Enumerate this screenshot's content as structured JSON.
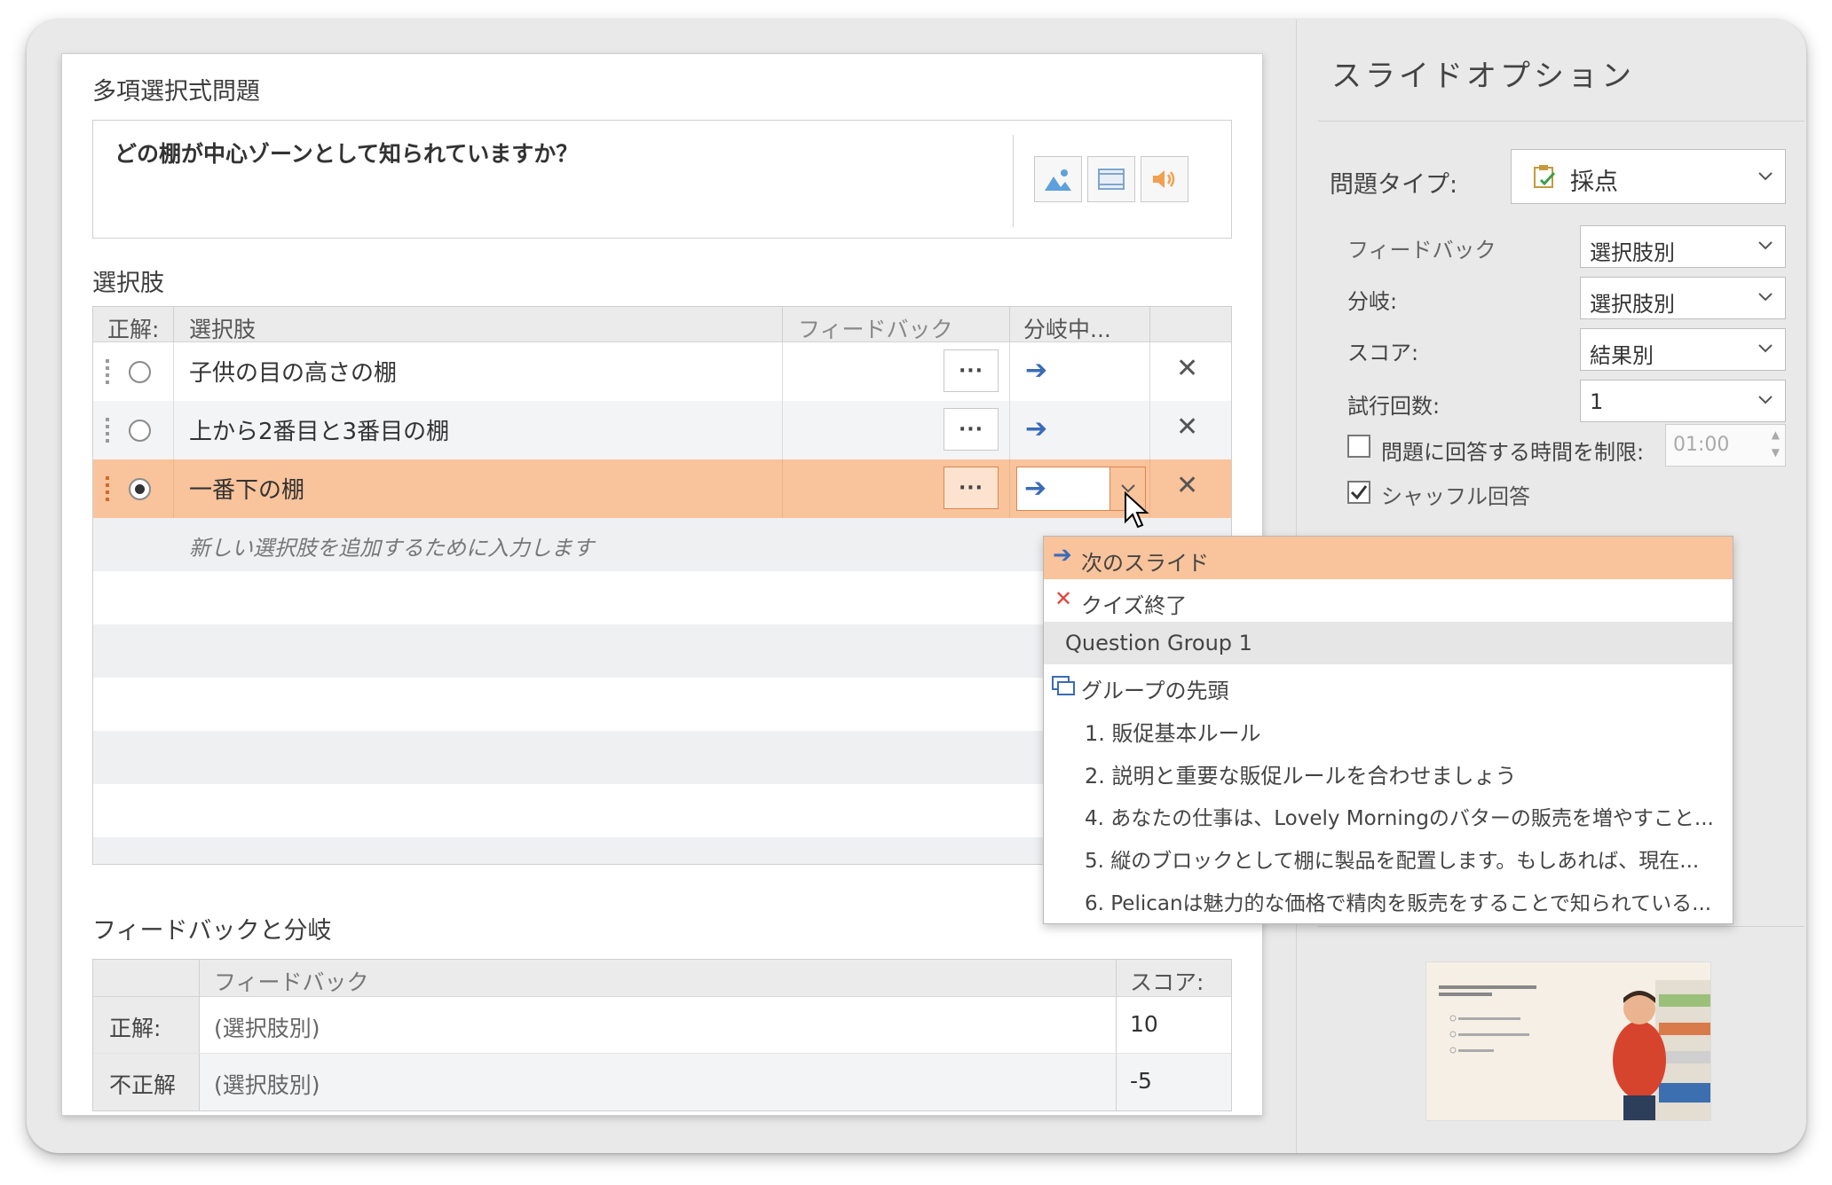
{
  "question": {
    "section_label": "多項選択式問題",
    "text": "どの棚が中心ゾーンとして知られていますか？"
  },
  "choices": {
    "section_label": "選択肢",
    "headers": [
      "正解:",
      "選択肢",
      "フィードバック",
      "分岐中..."
    ],
    "rows": [
      {
        "text": "子供の目の高さの棚",
        "correct": false
      },
      {
        "text": "上から2番目と3番目の棚",
        "correct": false
      },
      {
        "text": "一番下の棚",
        "correct": true
      }
    ],
    "feedback_button_label": "···",
    "placeholder": "新しい選択肢を追加するために入力します"
  },
  "feedback_branching": {
    "section_label": "フィードバックと分岐",
    "headers": [
      "フィードバック",
      "スコア:"
    ],
    "rows": [
      {
        "label": "正解:",
        "feedback": "(選択肢別)",
        "score": "10"
      },
      {
        "label": "不正解",
        "feedback": "(選択肢別)",
        "score": "-5"
      }
    ]
  },
  "slide_options": {
    "title": "スライドオプション",
    "question_type_label": "問題タイプ:",
    "question_type_value": "採点",
    "feedback_label": "フィードバック",
    "feedback_value": "選択肢別",
    "branching_label": "分岐:",
    "branching_value": "選択肢別",
    "score_label": "スコア:",
    "score_value": "結果別",
    "attempts_label": "試行回数:",
    "attempts_value": "1",
    "time_limit_label": "問題に回答する時間を制限:",
    "time_limit_value": "01:00",
    "time_limit_checked": false,
    "shuffle_label": "シャッフル回答",
    "shuffle_checked": true
  },
  "branch_dropdown": {
    "items": [
      {
        "label": "次のスライド",
        "icon": "arrow-right-icon"
      },
      {
        "label": "クイズ終了",
        "icon": "x-icon"
      },
      {
        "label": "Question Group 1",
        "group": true
      },
      {
        "label": "グループの先頭",
        "icon": "slides-icon"
      },
      {
        "label": "1. 販促基本ルール"
      },
      {
        "label": "2. 説明と重要な販促ルールを合わせましょう"
      },
      {
        "label": "4. あなたの仕事は、Lovely Morningのバターの販売を増やすこと..."
      },
      {
        "label": "5. 縦のブロックとして棚に製品を配置します。もしあれば、現在..."
      },
      {
        "label": "6. Pelicanは魅力的な価格で精肉を販売をすることで知られている..."
      }
    ]
  },
  "colors": {
    "highlight": "#f9c39b",
    "accent_orange": "#d9884f",
    "arrow_blue": "#3a6bb8",
    "x_red": "#e0443c"
  }
}
